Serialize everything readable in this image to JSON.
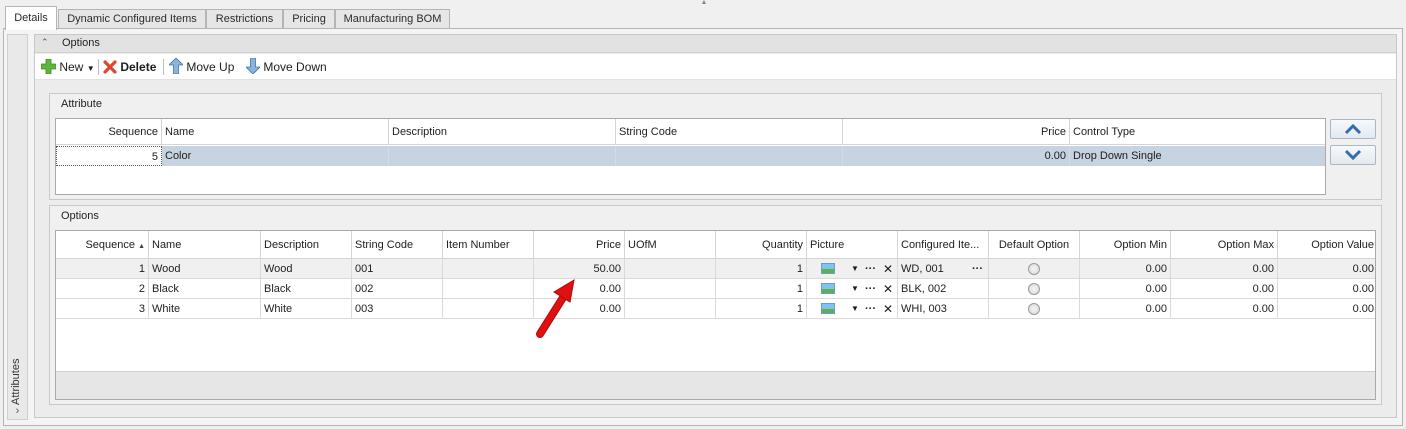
{
  "tabs": [
    "Details",
    "Dynamic Configured Items",
    "Restrictions",
    "Pricing",
    "Manufacturing BOM"
  ],
  "side_panel": {
    "label": "Attributes",
    "chevron": "›"
  },
  "options_panel": {
    "title": "Options",
    "collapse_icon": "^"
  },
  "toolbar": {
    "new_label": "New",
    "delete_label": "Delete",
    "move_up_label": "Move Up",
    "move_down_label": "Move Down"
  },
  "attribute_group": {
    "title": "Attribute",
    "columns": [
      "Sequence",
      "Name",
      "Description",
      "String Code",
      "Price",
      "Control Type"
    ],
    "rows": [
      {
        "sequence": "5",
        "name": "Color",
        "description": "",
        "string_code": "",
        "price": "0.00",
        "control_type": "Drop Down Single"
      }
    ]
  },
  "options_group": {
    "title": "Options",
    "columns": [
      "Sequence",
      "Name",
      "Description",
      "String Code",
      "Item Number",
      "Price",
      "UOfM",
      "Quantity",
      "Picture",
      "Configured Ite...",
      "Default Option",
      "Option Min",
      "Option Max",
      "Option Value"
    ],
    "sort_indicator": "▲",
    "rows": [
      {
        "sequence": "1",
        "name": "Wood",
        "description": "Wood",
        "string_code": "001",
        "item_number": "",
        "price": "50.00",
        "uofm": "",
        "quantity": "1",
        "configured_item": "WD, 001",
        "option_min": "0.00",
        "option_max": "0.00",
        "option_value": "0.00"
      },
      {
        "sequence": "2",
        "name": "Black",
        "description": "Black",
        "string_code": "002",
        "item_number": "",
        "price": "0.00",
        "uofm": "",
        "quantity": "1",
        "configured_item": "BLK, 002",
        "option_min": "0.00",
        "option_max": "0.00",
        "option_value": "0.00"
      },
      {
        "sequence": "3",
        "name": "White",
        "description": "White",
        "string_code": "003",
        "item_number": "",
        "price": "0.00",
        "uofm": "",
        "quantity": "1",
        "configured_item": "WHI, 003",
        "option_min": "0.00",
        "option_max": "0.00",
        "option_value": "0.00"
      }
    ]
  },
  "colors": {
    "selected_row": "#c6d3e0",
    "annotation_arrow": "#e01010",
    "move_button_icon": "#2f6fb5"
  }
}
